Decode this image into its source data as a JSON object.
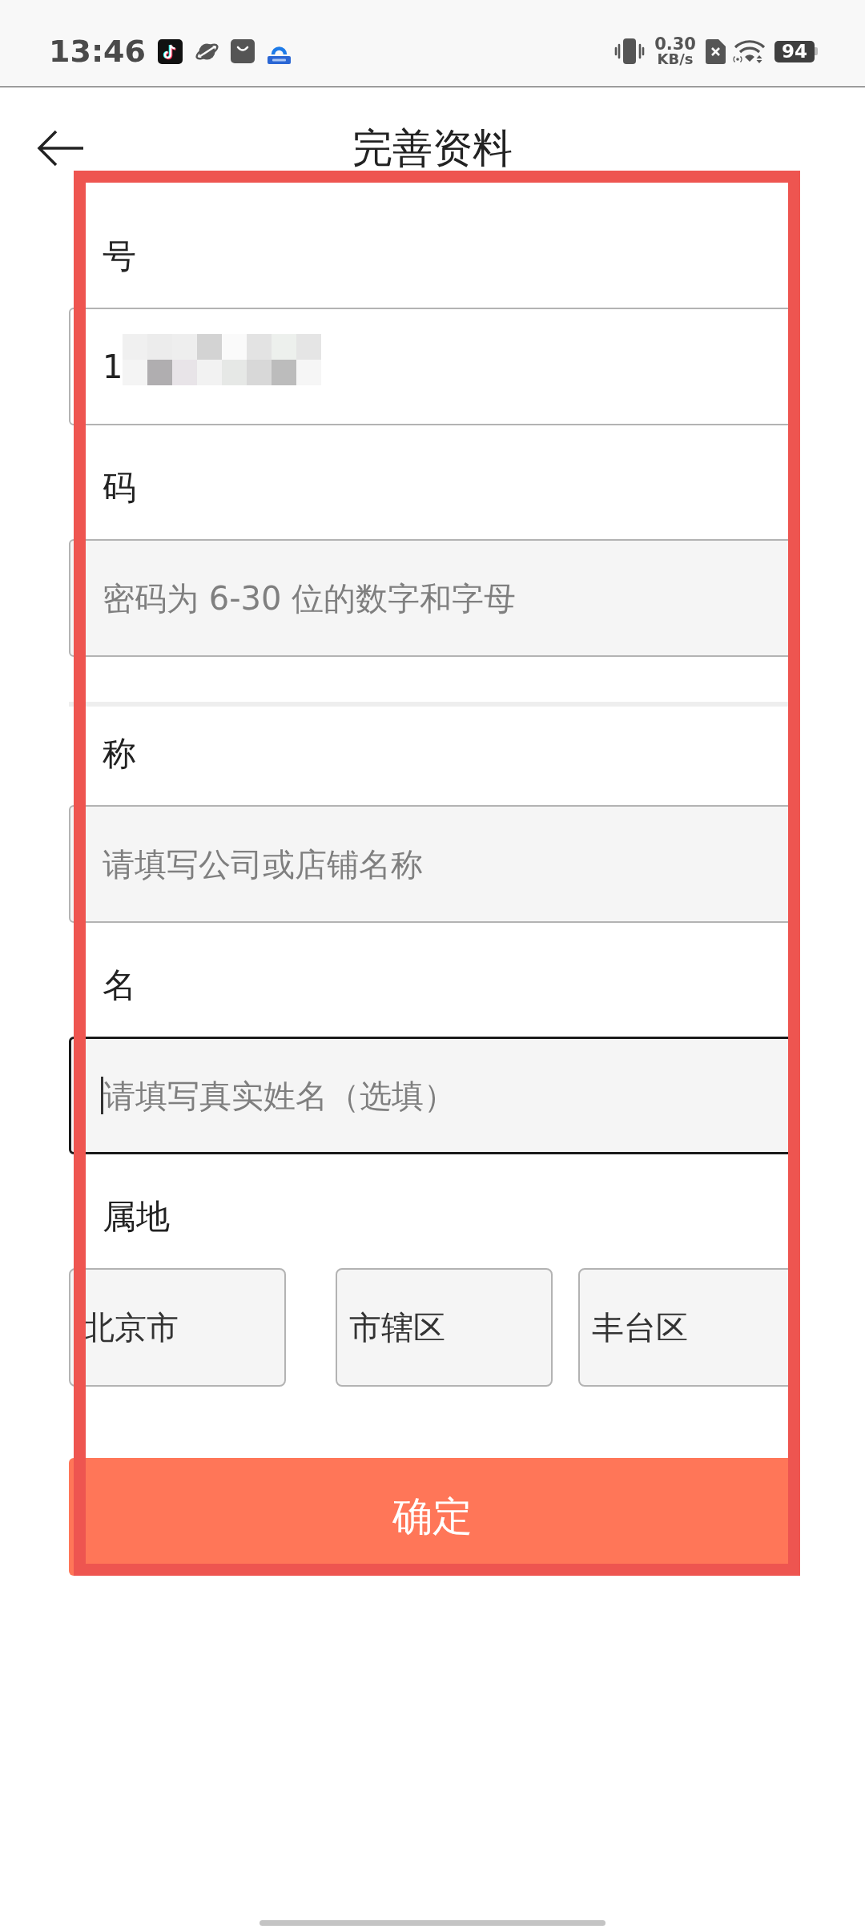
{
  "status_bar": {
    "time": "13:46",
    "network_speed": "0.30",
    "network_speed_unit": "KB/s",
    "battery": "94"
  },
  "header": {
    "title": "完善资料"
  },
  "sections": [
    {
      "fields": [
        {
          "kind": "text",
          "label": "号",
          "value": "1",
          "redacted": true,
          "focused": false
        },
        {
          "kind": "text",
          "label": "码",
          "placeholder": "密码为 6-30 位的数字和字母",
          "focused": false
        }
      ]
    },
    {
      "fields": [
        {
          "kind": "text",
          "label": "称",
          "placeholder": "请填写公司或店铺名称",
          "focused": false
        },
        {
          "kind": "text",
          "label": "名",
          "placeholder": "请填写真实姓名（选填）",
          "focused": true
        },
        {
          "kind": "region",
          "label": "属地",
          "selects": [
            {
              "value": "北京市"
            },
            {
              "value": "市辖区"
            },
            {
              "value": "丰台区"
            }
          ]
        }
      ]
    }
  ],
  "submit_button": {
    "label": "确定"
  }
}
